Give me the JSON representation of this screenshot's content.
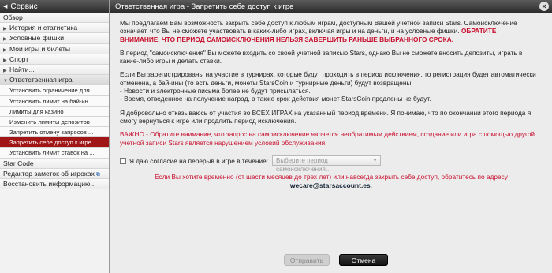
{
  "sidebar": {
    "header": "Сервис",
    "items": [
      {
        "label": "Обзор",
        "kind": "plain"
      },
      {
        "label": "История и статистика",
        "kind": "collapsed"
      },
      {
        "label": "Условные фишки",
        "kind": "collapsed"
      },
      {
        "label": "Мои игры и билеты",
        "kind": "collapsed"
      },
      {
        "label": "Спорт",
        "kind": "collapsed"
      },
      {
        "label": "Найти...",
        "kind": "collapsed"
      },
      {
        "label": "Ответственная игра",
        "kind": "open"
      },
      {
        "label": "Установить ограничение для ...",
        "kind": "sub"
      },
      {
        "label": "Установить лимит на бай-ин...",
        "kind": "sub"
      },
      {
        "label": "Лимиты для казино",
        "kind": "sub"
      },
      {
        "label": "Изменить лимиты депозитов",
        "kind": "sub"
      },
      {
        "label": "Запретить отмену запросов ...",
        "kind": "sub"
      },
      {
        "label": "Запретить себе доступ к игре",
        "kind": "sub-active"
      },
      {
        "label": "Установить лимит ставок на ...",
        "kind": "sub"
      },
      {
        "label": "Star Code",
        "kind": "plain"
      },
      {
        "label": "Редактор заметок об игроках",
        "kind": "plain-ext"
      },
      {
        "label": "Восстановить информацию...",
        "kind": "plain"
      }
    ]
  },
  "main": {
    "title": "Ответственная игра - Запретить себе доступ к игре",
    "p1": "Мы предлагаем Вам возможность закрыть себе доступ к любым играм, доступным Вашей учетной записи Stars. Самоисключение означает, что Вы не сможете участвовать в каких-либо играх, включая игры и на деньги, и на условные фишки.",
    "p1_warning": "ОБРАТИТЕ ВНИМАНИЕ, ЧТО ПЕРИОД САМОИСКЛЮЧЕНИЯ НЕЛЬЗЯ ЗАВЕРШИТЬ РАНЬШЕ ВЫБРАННОГО СРОКА.",
    "p2": "В период \"самоисключения\" Вы можете входить со своей учетной записью Stars, однако Вы не сможете вносить депозиты, играть в какие-либо игры и делать ставки.",
    "p3_lines": [
      "Если Вы зарегистрированы на участие в турнирах, которые будут проходить в период исключения, то регистрация будет автоматически отменена, а бай-ины (то есть деньги, монеты StarsCoin и турнирные деньги) будут возвращены:",
      "- Новости и электронные письма более не будут присылаться.",
      "- Время, отведенное на получение наград, а также срок действия монет StarsCoin продлены не будут."
    ],
    "p4": "Я добровольно отказываюсь от участия во ВСЕХ ИГРАХ на указанный период времени. Я понимаю, что по окончании этого периода я смогу вернуться к игре или продлить период исключения.",
    "p5": "ВАЖНО - Обратите внимание, что запрос на самоисключение является необратимым действием, создание или игра с помощью другой учетной записи Stars является нарушением условий обслуживания.",
    "consent_label": "Я даю согласие на перерыв в игре в течение:",
    "select_placeholder": "Выберите период самоисключения...",
    "contact_msg": "Если Вы хотите временно (от шести месяцев до трех лет) или навсегда закрыть себе доступ, обратитесь по адресу",
    "email": "wecare@starsaccount.es",
    "email_suffix": ".",
    "save_label": "Отправить",
    "cancel_label": "Отмена"
  }
}
